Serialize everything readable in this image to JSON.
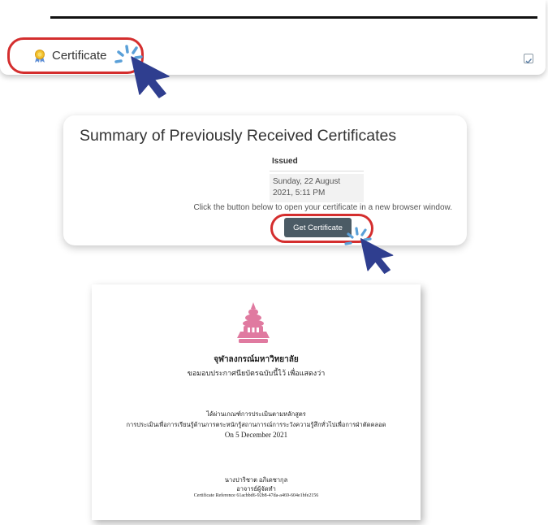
{
  "activity": {
    "certificate_label": "Certificate"
  },
  "summary": {
    "title": "Summary of Previously Received Certificates",
    "table": {
      "header": "Issued",
      "row_value": "Sunday, 22 August 2021, 5:11 PM"
    },
    "hint": "Click the button below to open your certificate in a new browser window.",
    "button_label": "Get Certificate"
  },
  "certificate": {
    "institution": "จุฬาลงกรณ์มหาวิทยาลัย",
    "intro": "ขอมอบประกาศนียบัตรฉบับนี้ไว้ เพื่อแสดงว่า",
    "passed": "ได้ผ่านเกณฑ์การประเมินตามหลักสูตร",
    "course": "การประเมินเพื่อการเรียนรู้ด้านการตระหนักรู้สถานการณ์การระวังความรู้สึกทั่วไปเพื่อการฝ่าตัดคลอด",
    "date": "On 5 December 2021",
    "signer_name": "นางปาริชาต อภิเดชากุล",
    "signer_title": "อาจารย์ผู้จัดทำ",
    "reference": "Certificate Reference 61acbbd6-92b8-47da-a469-604e1bfe2156"
  },
  "colors": {
    "highlight_ring": "#d42e2e",
    "cursor": "#2f3e8f",
    "button_bg": "#4b5b65",
    "emblem": "#e07aa0"
  },
  "icons": [
    "award-ribbon-icon",
    "checkbox-icon",
    "cursor-arrow-icon",
    "click-burst-icon",
    "university-emblem-icon"
  ]
}
